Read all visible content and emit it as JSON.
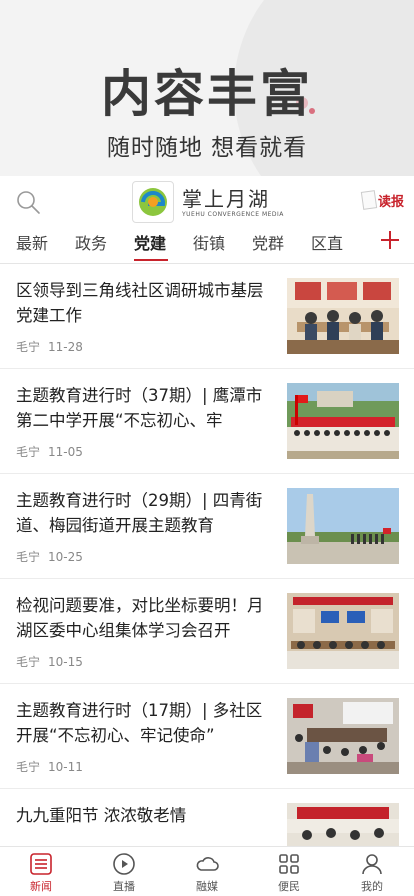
{
  "promo": {
    "headline": "内容丰富",
    "tagline": "随时随地 想看就看"
  },
  "appbar": {
    "logo_title": "掌上月湖",
    "logo_subtitle": "YUEHU CONVERGENCE MEDIA",
    "read_paper_label": "读报"
  },
  "tabs": [
    {
      "label": "最新"
    },
    {
      "label": "政务"
    },
    {
      "label": "党建",
      "active": true
    },
    {
      "label": "街镇"
    },
    {
      "label": "党群"
    },
    {
      "label": "区直"
    }
  ],
  "news": [
    {
      "title": "区领导到三角线社区调研城市基层党建工作",
      "source": "毛宁",
      "date": "11-28",
      "thumb": "meeting-room"
    },
    {
      "title": "主题教育进行时（37期）|  鹰潭市第二中学开展“不忘初心、牢",
      "source": "毛宁",
      "date": "11-05",
      "thumb": "group-banner"
    },
    {
      "title": "主题教育进行时（29期）|  四青街道、梅园街道开展主题教育",
      "source": "毛宁",
      "date": "10-25",
      "thumb": "monument"
    },
    {
      "title": "检视问题要准，对比坐标要明！月湖区委中心组集体学习会召开",
      "source": "毛宁",
      "date": "10-15",
      "thumb": "conference"
    },
    {
      "title": "主题教育进行时（17期）|  多社区开展“不忘初心、牢记使命”",
      "source": "毛宁",
      "date": "10-11",
      "thumb": "classroom"
    },
    {
      "title": "九九重阳节  浓浓敬老情",
      "source": "",
      "date": "",
      "thumb": "elderly-gathering"
    }
  ],
  "bottom_nav": [
    {
      "label": "新闻",
      "icon": "news-list-icon",
      "active": true
    },
    {
      "label": "直播",
      "icon": "play-icon"
    },
    {
      "label": "融媒",
      "icon": "cloud-icon"
    },
    {
      "label": "便民",
      "icon": "grid-icon"
    },
    {
      "label": "我的",
      "icon": "user-icon"
    }
  ],
  "colors": {
    "accent": "#c8232c",
    "text": "#222222",
    "meta": "#888888"
  }
}
